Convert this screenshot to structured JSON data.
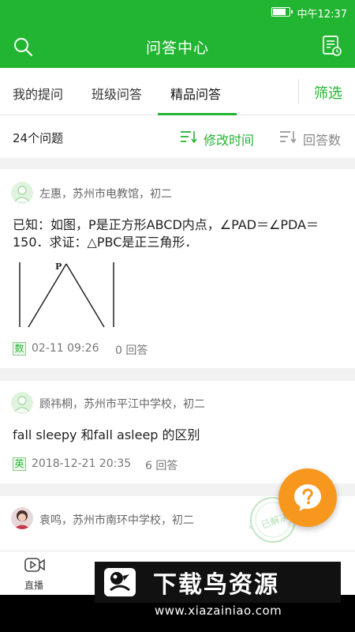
{
  "status_bar": {
    "time": "中午12:37",
    "battery_level": 0.85
  },
  "header": {
    "title": "问答中心"
  },
  "tabs": [
    {
      "label": "我的提问"
    },
    {
      "label": "班级问答"
    },
    {
      "label": "精品问答",
      "active": true
    }
  ],
  "filter_label": "筛选",
  "sort_bar": {
    "count": "24个问题",
    "sort_time": "修改时间",
    "sort_answers": "回答数"
  },
  "questions": [
    {
      "author_meta": "左惠，苏州市电教馆，初二",
      "text": "已知：如图，P是正方形ABCD内点，∠PAD＝∠PDA＝150．求证：△PBC是正三角形．",
      "figure_label": "P",
      "subject": "数",
      "date": "02-11 09:26",
      "answers": "0 回答"
    },
    {
      "author_meta": "顾祎桐，苏州市平江中学校，初二",
      "text": "fall sleepy 和fall asleep 的区别",
      "subject": "英",
      "date": "2018-12-21 20:35",
      "answers": "6 回答"
    },
    {
      "author_meta": "袁鸣，苏州市南环中学校，初二",
      "stamp": "已解决"
    }
  ],
  "bottom_nav": {
    "live_label": "直播"
  },
  "watermark": {
    "title": "下载鸟资源",
    "url": "www.xiazainiao.com"
  },
  "colors": {
    "primary": "#22b531",
    "fab": "#f8971d"
  }
}
